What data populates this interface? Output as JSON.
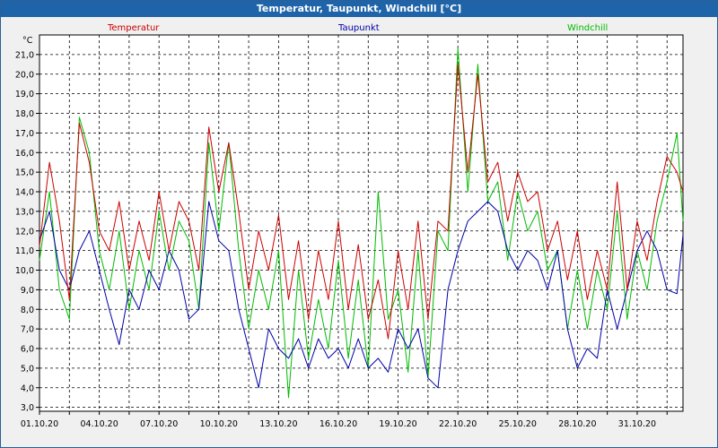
{
  "window": {
    "title": "Temperatur, Taupunkt, Windchill [°C]"
  },
  "colors": {
    "temperatur": "#cc0000",
    "taupunkt": "#0000aa",
    "windchill": "#00bb00"
  },
  "chart_data": {
    "type": "line",
    "unit_label": "°C",
    "ylim": [
      2.8,
      22.0
    ],
    "y_ticks": [
      "3,0",
      "4,0",
      "5,0",
      "6,0",
      "7,0",
      "8,0",
      "9,0",
      "10,0",
      "11,0",
      "12,0",
      "13,0",
      "14,0",
      "15,0",
      "16,0",
      "17,0",
      "18,0",
      "19,0",
      "20,0",
      "21,0"
    ],
    "y_tick_values": [
      3,
      4,
      5,
      6,
      7,
      8,
      9,
      10,
      11,
      12,
      13,
      14,
      15,
      16,
      17,
      18,
      19,
      20,
      21
    ],
    "x_range": [
      0,
      32.3
    ],
    "x_tick_labels": [
      "01.10.20",
      "04.10.20",
      "07.10.20",
      "10.10.20",
      "13.10.20",
      "16.10.20",
      "19.10.20",
      "22.10.20",
      "25.10.20",
      "28.10.20",
      "31.10.20"
    ],
    "x_tick_values": [
      0,
      3,
      6,
      9,
      12,
      15,
      18,
      21,
      24,
      27,
      30
    ],
    "x_grid_values": [
      0,
      1.5,
      3,
      4.5,
      6,
      7.5,
      9,
      10.5,
      12,
      13.5,
      15,
      16.5,
      18,
      19.5,
      21,
      22.5,
      24,
      25.5,
      27,
      28.5,
      30,
      31.5
    ],
    "grid": true,
    "legend_placement": "top",
    "series": [
      {
        "name": "Temperatur",
        "x": [
          0,
          0.5,
          1,
          1.5,
          2,
          2.5,
          3,
          3.5,
          4,
          4.5,
          5,
          5.5,
          6,
          6.5,
          7,
          7.5,
          8,
          8.5,
          9,
          9.5,
          10,
          10.5,
          11,
          11.5,
          12,
          12.5,
          13,
          13.5,
          14,
          14.5,
          15,
          15.5,
          16,
          16.5,
          17,
          17.5,
          18,
          18.5,
          19,
          19.5,
          20,
          20.5,
          21,
          21.5,
          22,
          22.5,
          23,
          23.5,
          24,
          24.5,
          25,
          25.5,
          26,
          26.5,
          27,
          27.5,
          28,
          28.5,
          29,
          29.5,
          30,
          30.5,
          31,
          31.5,
          32,
          32.3
        ],
        "values": [
          11.2,
          15.5,
          12.5,
          8.5,
          17.5,
          15.5,
          12,
          11,
          13.5,
          10,
          12.5,
          10.5,
          14,
          11,
          13.5,
          12.5,
          10,
          17.3,
          14,
          16.5,
          13,
          9,
          12,
          10,
          12.8,
          8.5,
          11.5,
          7.5,
          11,
          8.5,
          12.5,
          8,
          11.3,
          7.5,
          9.5,
          6.5,
          11,
          8,
          12.5,
          7.5,
          12.5,
          12,
          20.5,
          15,
          20,
          14.5,
          15.5,
          12.5,
          15,
          13.5,
          14,
          11,
          12.5,
          9.5,
          12,
          8.5,
          11,
          9,
          14.5,
          9,
          12.5,
          10.5,
          13.5,
          15.8,
          15,
          14
        ]
      },
      {
        "name": "Taupunkt",
        "x": [
          0,
          0.5,
          1,
          1.5,
          2,
          2.5,
          3,
          3.5,
          4,
          4.5,
          5,
          5.5,
          6,
          6.5,
          7,
          7.5,
          8,
          8.5,
          9,
          9.5,
          10,
          10.5,
          11,
          11.5,
          12,
          12.5,
          13,
          13.5,
          14,
          14.5,
          15,
          15.5,
          16,
          16.5,
          17,
          17.5,
          18,
          18.5,
          19,
          19.5,
          20,
          20.5,
          21,
          21.5,
          22,
          22.5,
          23,
          23.5,
          24,
          24.5,
          25,
          25.5,
          26,
          26.5,
          27,
          27.5,
          28,
          28.5,
          29,
          29.5,
          30,
          30.5,
          31,
          31.5,
          32,
          32.3
        ],
        "values": [
          11.5,
          13,
          10,
          9,
          11,
          12,
          10,
          8,
          6.2,
          9,
          8,
          10,
          9,
          11,
          10,
          7.5,
          8,
          13.5,
          11.5,
          11,
          8,
          6,
          4,
          7,
          6,
          5.5,
          6.5,
          5,
          6.5,
          5.5,
          6,
          5,
          6.5,
          5,
          5.5,
          4.8,
          7,
          6,
          7,
          4.5,
          4,
          9,
          11,
          12.5,
          13,
          13.5,
          13,
          11,
          10,
          11,
          10.5,
          9,
          11,
          7,
          5,
          6,
          5.5,
          9,
          7,
          9,
          11,
          12,
          11,
          9,
          8.8,
          11.8
        ]
      },
      {
        "name": "Windchill",
        "x": [
          0,
          0.5,
          1,
          1.5,
          2,
          2.5,
          3,
          3.5,
          4,
          4.5,
          5,
          5.5,
          6,
          6.5,
          7,
          7.5,
          8,
          8.5,
          9,
          9.5,
          10,
          10.5,
          11,
          11.5,
          12,
          12.5,
          13,
          13.5,
          14,
          14.5,
          15,
          15.5,
          16,
          16.5,
          17,
          17.5,
          18,
          18.5,
          19,
          19.5,
          20,
          20.5,
          21,
          21.5,
          22,
          22.5,
          23,
          23.5,
          24,
          24.5,
          25,
          25.5,
          26,
          26.5,
          27,
          27.5,
          28,
          28.5,
          29,
          29.5,
          30,
          30.5,
          31,
          31.5,
          32,
          32.3
        ],
        "values": [
          10.5,
          14,
          9,
          7.5,
          17.8,
          16,
          11,
          9,
          12,
          8,
          11,
          9,
          13,
          10,
          12.5,
          11.5,
          8,
          16.5,
          12,
          16.5,
          11,
          7,
          10,
          8,
          11,
          3.5,
          10,
          5.5,
          8.5,
          6,
          10.5,
          5.5,
          9.5,
          5,
          14,
          7.5,
          9,
          4.8,
          11,
          4.5,
          12,
          11,
          21.3,
          14,
          20.5,
          13.5,
          14.5,
          10.5,
          14,
          12,
          13,
          10,
          11,
          7,
          10,
          7,
          10,
          8,
          13,
          7.5,
          11,
          9,
          12.5,
          14.5,
          17,
          12.5
        ]
      }
    ]
  }
}
